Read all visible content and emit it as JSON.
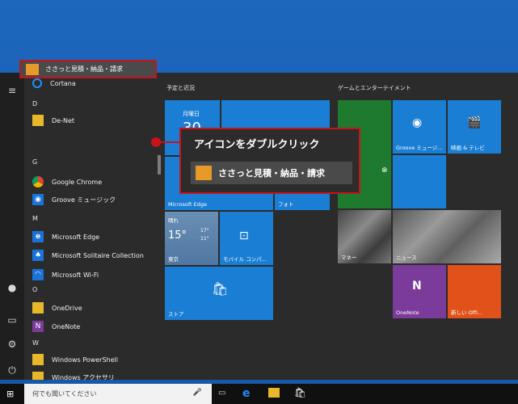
{
  "applist": {
    "cortana": "Cortana",
    "d": "D",
    "denet": "De-Net",
    "app_sasatto": "ささっと見積・納品・請求",
    "g": "G",
    "google_chrome": "Google Chrome",
    "groove": "Groove ミュージック",
    "m": "M",
    "edge": "Microsoft Edge",
    "solitaire": "Microsoft Solitaire Collection",
    "wifi": "Microsoft Wi-Fi",
    "o": "O",
    "onedrive": "OneDrive",
    "onenote": "OneNote",
    "w": "W",
    "powershell": "Windows PowerShell",
    "accessories": "Windows アクセサリ"
  },
  "tiles": {
    "group1_title": "予定と近況",
    "group2_title": "ゲームとエンターテイメント",
    "calendar_day": "月曜日",
    "calendar_num": "30",
    "edge": "Microsoft Edge",
    "photos": "フォト",
    "weather_status": "晴れ",
    "weather_temp": "15°",
    "weather_hi": "17°",
    "weather_lo": "11°",
    "weather_city": "東京",
    "mobile": "モバイル コンパ...",
    "store": "ストア",
    "groove": "Groove ミュージ...",
    "movies": "映画 & テレビ",
    "money": "マネー",
    "news": "ニュース",
    "onenote": "OneNote",
    "office": "新しい Offi..."
  },
  "callout": {
    "instruction": "アイコンをダブルクリック",
    "app_label": "ささっと見積・納品・請求"
  },
  "taskbar": {
    "search_placeholder": "何でも聞いてください"
  }
}
